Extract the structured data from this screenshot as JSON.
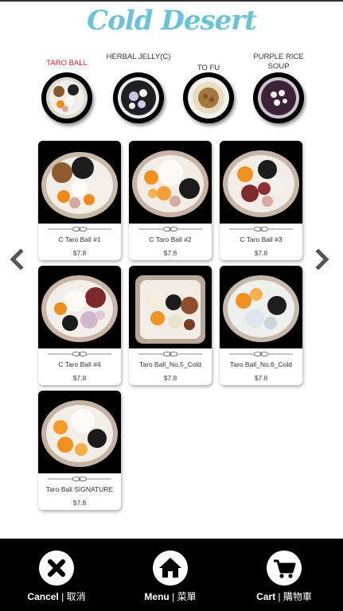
{
  "app": {
    "title": "Cold Desert"
  },
  "categories": [
    {
      "label": "TARO BALL",
      "active": true,
      "icon": "taro-ball-dessert-icon"
    },
    {
      "label": "HERBAL JELLY(C)",
      "active": false,
      "icon": "herbal-jelly-dessert-icon"
    },
    {
      "label": "TO FU",
      "active": false,
      "icon": "tofu-dessert-icon"
    },
    {
      "label": "PURPLE RICE SOUP",
      "active": false,
      "icon": "purple-rice-soup-icon"
    }
  ],
  "products": [
    {
      "name": "C Taro Ball #1",
      "price": "$7.8"
    },
    {
      "name": "C Taro Ball #2",
      "price": "$7.8"
    },
    {
      "name": "C Taro Ball #3",
      "price": "$7.8"
    },
    {
      "name": "C Taro Ball #4",
      "price": "$7.8"
    },
    {
      "name": "Taro Ball_No.5_Cold",
      "price": "$7.8"
    },
    {
      "name": "Taro Ball_No.6_Cold",
      "price": "$7.8"
    },
    {
      "name": "Taro Ball SIGNATURE",
      "price": "$7.8"
    }
  ],
  "nav": {
    "cancel": {
      "en": "Cancel",
      "sep": " | ",
      "zh": "取消",
      "icon": "close-icon"
    },
    "menu": {
      "en": "Menu",
      "sep": " | ",
      "zh": "菜單",
      "icon": "home-icon"
    },
    "cart": {
      "en": "Cart",
      "sep": " | ",
      "zh": "購物車",
      "icon": "cart-icon"
    }
  },
  "colors": {
    "title": "#6cc3d8",
    "active_category": "#e02020",
    "bottom_bar": "#000000",
    "arrow": "#555555"
  }
}
